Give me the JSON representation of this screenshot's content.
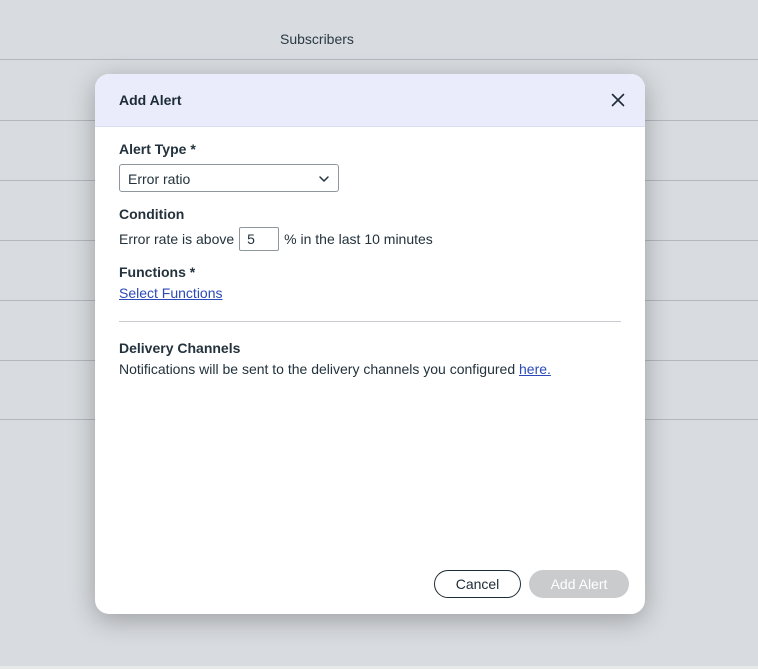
{
  "background": {
    "column_header": "Subscribers"
  },
  "modal": {
    "title": "Add Alert",
    "close_icon": "close-icon",
    "alert_type": {
      "label": "Alert Type *",
      "selected": "Error ratio",
      "icon": "chevron-down-icon"
    },
    "condition": {
      "label": "Condition",
      "prefix": "Error rate is above",
      "value": "5",
      "suffix": "% in the last 10 minutes"
    },
    "functions": {
      "label": "Functions *",
      "link": "Select Functions"
    },
    "delivery": {
      "label": "Delivery Channels",
      "text": "Notifications will be sent to the delivery channels you configured",
      "link": "here."
    },
    "buttons": {
      "cancel": "Cancel",
      "add": "Add Alert"
    }
  },
  "colors": {
    "header_bg": "#eaecfb",
    "link": "#2b4ab8",
    "disabled_button": "#c9cbcd",
    "page_bg": "#d8dbdf"
  }
}
